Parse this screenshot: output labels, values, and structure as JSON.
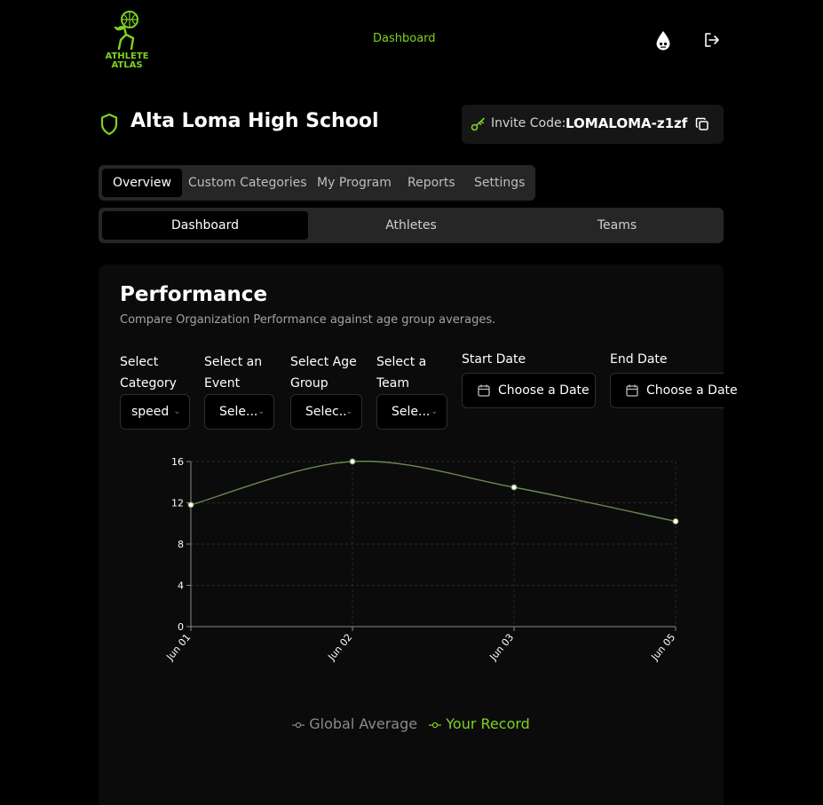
{
  "header": {
    "logo_text_line1": "ATHLETE",
    "logo_text_line2": "ATLAS",
    "nav_link": "Dashboard",
    "accent": "#7ed321"
  },
  "org": {
    "title": "Alta Loma High School",
    "invite_label": "Invite Code:",
    "invite_code": "LOMALOMA-z1zf"
  },
  "tabs": [
    {
      "label": "Overview",
      "active": true
    },
    {
      "label": "Custom Categories"
    },
    {
      "label": "My Program"
    },
    {
      "label": "Reports"
    },
    {
      "label": "Settings"
    }
  ],
  "subtabs": [
    {
      "label": "Dashboard",
      "active": true
    },
    {
      "label": "Athletes"
    },
    {
      "label": "Teams"
    }
  ],
  "performance": {
    "title": "Performance",
    "subtitle": "Compare Organization Performance against age group averages.",
    "filters": {
      "category": {
        "label_line1": "Select",
        "label_line2": "Category",
        "value": "speed"
      },
      "event": {
        "label_line1": "Select an",
        "label_line2": "Event",
        "value": "Sele..."
      },
      "age_group": {
        "label_line1": "Select Age",
        "label_line2": "Group",
        "value": "Selec.."
      },
      "team": {
        "label_line1": "Select a",
        "label_line2": "Team",
        "value": "Sele..."
      },
      "start_date": {
        "label": "Start Date",
        "value": "Choose a Date"
      },
      "end_date": {
        "label": "End Date",
        "value": "Choose a Date"
      }
    }
  },
  "chart_data": {
    "type": "line",
    "categories": [
      "Jun 01",
      "Jun 02",
      "Jun 03",
      "Jun 05"
    ],
    "series": [
      {
        "name": "Global Average",
        "values": [
          11.8,
          16,
          13.5,
          10.2
        ],
        "color": "#9aa3a3"
      },
      {
        "name": "Your Record",
        "values": [
          11.8,
          16,
          13.5,
          10.2
        ],
        "color": "#7ed321"
      }
    ],
    "y_ticks": [
      0,
      4,
      8,
      12,
      16
    ],
    "ylim": [
      0,
      16
    ],
    "grid": true,
    "legend_position": "bottom"
  }
}
